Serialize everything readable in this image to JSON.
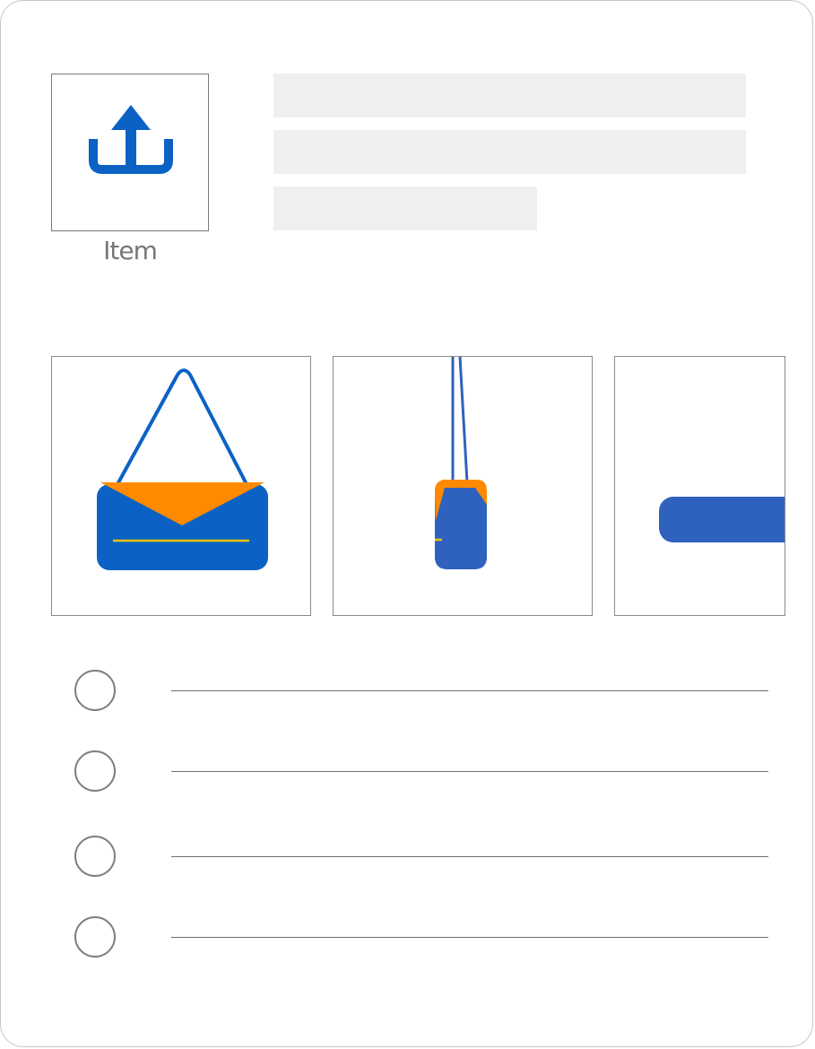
{
  "upload": {
    "label": "Item",
    "icon": "upload-icon",
    "icon_color": "#0b62c4"
  },
  "skeleton_color": "#efefef",
  "images": [
    {
      "name": "handbag-front",
      "colors": {
        "body": "#0b62c4",
        "flap": "#ff8a00",
        "stitch": "#f2c200"
      }
    },
    {
      "name": "handbag-side",
      "colors": {
        "body": "#2f62bf",
        "flap": "#ff8a00",
        "stitch": "#f2c200"
      }
    },
    {
      "name": "handbag-bottom",
      "colors": {
        "body": "#2f62bf"
      }
    }
  ],
  "options": [
    {
      "selected": false,
      "text": ""
    },
    {
      "selected": false,
      "text": ""
    },
    {
      "selected": false,
      "text": ""
    },
    {
      "selected": false,
      "text": ""
    }
  ]
}
